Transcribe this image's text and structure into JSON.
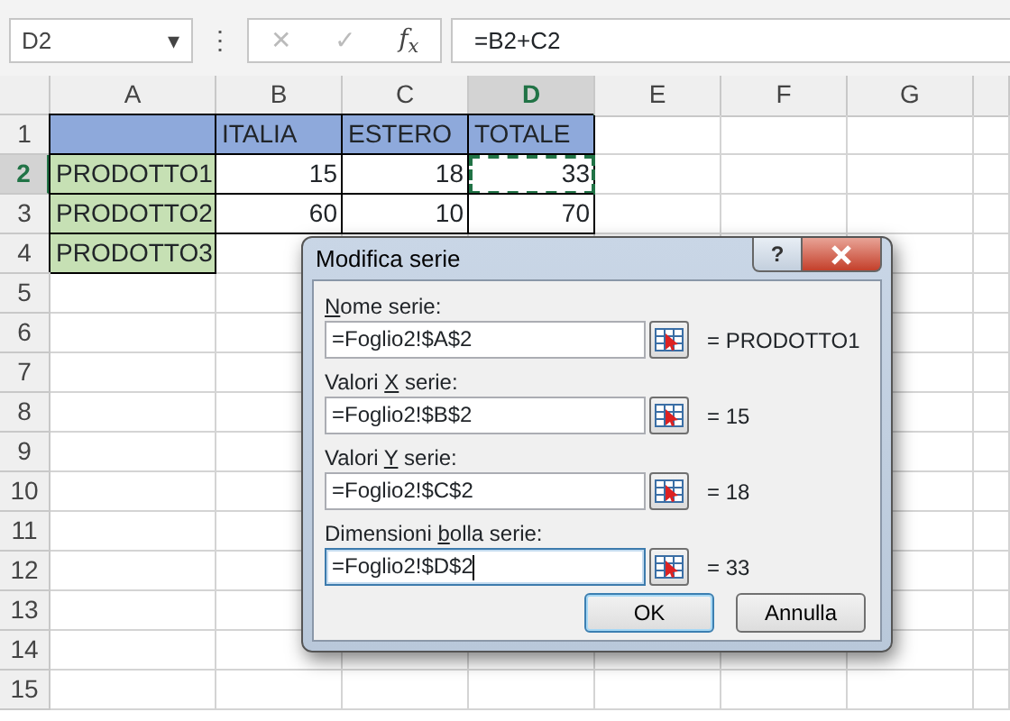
{
  "name_box": {
    "value": "D2",
    "caret": "▾"
  },
  "formula_bar": {
    "more": "⋮",
    "cancel": {
      "glyph": "✕",
      "disabled": true
    },
    "enter": {
      "glyph": "✓",
      "disabled": true
    },
    "function_label": "f$_{x}$",
    "value": "=B2+C2"
  },
  "columns": [
    {
      "label": "A",
      "selected": false
    },
    {
      "label": "B",
      "selected": false
    },
    {
      "label": "C",
      "selected": false
    },
    {
      "label": "D",
      "selected": true
    },
    {
      "label": "E",
      "selected": false
    },
    {
      "label": "F",
      "selected": false
    },
    {
      "label": "G",
      "selected": false
    }
  ],
  "rows": [
    {
      "label": "1",
      "selected": false,
      "cells": [
        {
          "color": "#8ea9db",
          "boxed": true
        },
        {
          "text": "ITALIA",
          "kind": "text",
          "color": "#8ea9db",
          "boxed": true
        },
        {
          "text": "ESTERO",
          "kind": "text",
          "color": "#8ea9db",
          "boxed": true
        },
        {
          "text": "TOTALE",
          "kind": "text",
          "color": "#8ea9db",
          "boxed": true
        },
        null,
        null,
        null
      ]
    },
    {
      "label": "2",
      "selected": true,
      "cells": [
        {
          "text": "PRODOTTO1",
          "kind": "text",
          "color": "#c6e0b4",
          "boxed": true
        },
        {
          "text": "15",
          "kind": "number",
          "boxed": true
        },
        {
          "text": "18",
          "kind": "number",
          "boxed": true
        },
        {
          "text": "33",
          "kind": "number",
          "boxed": true,
          "selected": true
        },
        null,
        null,
        null
      ]
    },
    {
      "label": "3",
      "selected": false,
      "cells": [
        {
          "text": "PRODOTTO2",
          "kind": "text",
          "color": "#c6e0b4",
          "boxed": true
        },
        {
          "text": "60",
          "kind": "number",
          "boxed": true
        },
        {
          "text": "10",
          "kind": "number",
          "boxed": true
        },
        {
          "text": "70",
          "kind": "number",
          "boxed": true
        },
        null,
        null,
        null
      ]
    },
    {
      "label": "4",
      "selected": false,
      "cells": [
        {
          "text": "PRODOTTO3",
          "kind": "text",
          "color": "#c6e0b4",
          "boxed": true
        },
        null,
        null,
        null,
        null,
        null,
        null
      ]
    },
    {
      "label": "5",
      "selected": false
    },
    {
      "label": "6",
      "selected": false
    },
    {
      "label": "7",
      "selected": false
    },
    {
      "label": "8",
      "selected": false
    },
    {
      "label": "9",
      "selected": false
    },
    {
      "label": "10",
      "selected": false
    },
    {
      "label": "11",
      "selected": false
    },
    {
      "label": "12",
      "selected": false
    },
    {
      "label": "13",
      "selected": false
    },
    {
      "label": "14",
      "selected": false
    },
    {
      "label": "15",
      "selected": false
    }
  ],
  "dialog": {
    "title": "Modifica serie",
    "help_button": "?",
    "fields": [
      {
        "access_key": "N",
        "label_after": "ome serie:",
        "value": "=Foglio2!$A$2",
        "result": "= PRODOTTO1",
        "focused": false
      },
      {
        "label_before": "Valori ",
        "access_key": "X",
        "label_after": " serie:",
        "value": "=Foglio2!$B$2",
        "result": "= 15",
        "focused": false
      },
      {
        "label_before": "Valori ",
        "access_key": "Y",
        "label_after": " serie:",
        "value": "=Foglio2!$C$2",
        "result": "= 18",
        "focused": false
      },
      {
        "label_before": "Dimensioni ",
        "access_key": "b",
        "label_after": "olla serie:",
        "value": "=Foglio2!$D$2",
        "result": "= 33",
        "focused": true
      }
    ],
    "buttons": [
      {
        "label": "OK",
        "default": true
      },
      {
        "label": "Annulla",
        "default": false
      }
    ]
  }
}
